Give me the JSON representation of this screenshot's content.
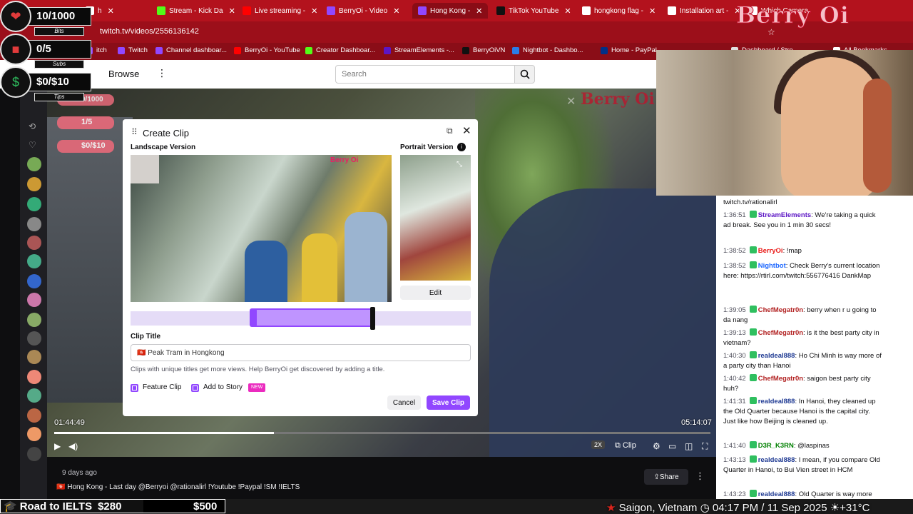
{
  "browser": {
    "tabs": [
      {
        "label": "h",
        "color": "#ffffff"
      },
      {
        "label": "Stream - Kick Da",
        "color": "#53fc18"
      },
      {
        "label": "Live streaming -",
        "color": "#ff0000"
      },
      {
        "label": "BerryOi - Video",
        "color": "#9147ff"
      },
      {
        "label": "Hong Kong -",
        "color": "#9147ff"
      },
      {
        "label": "TikTok YouTube",
        "color": "#111111"
      },
      {
        "label": "hongkong flag -",
        "color": "#ffffff"
      },
      {
        "label": "Installation art -",
        "color": "#ffffff"
      },
      {
        "label": "Which Camera",
        "color": "#ffffff"
      }
    ],
    "url": "twitch.tv/videos/2556136142",
    "bookmarks": [
      "itch",
      "Twitch",
      "Channel dashboar...",
      "BerryOi - YouTube",
      "Creator Dashboar...",
      "StreamElements -...",
      "BerryOiVN",
      "Nightbot - Dashbo...",
      "Home - PayPal",
      "Dashboard / Stre...",
      "All Bookmarks"
    ]
  },
  "twitch": {
    "browse": "Browse",
    "search_placeholder": "Search"
  },
  "overlay": {
    "bits": {
      "value": "10/1000",
      "label": "Bits"
    },
    "subs": {
      "value": "0/5",
      "label": "Subs"
    },
    "tips": {
      "value": "$0/$10",
      "label": "Tips"
    },
    "video_bits": "0/1000",
    "video_subs": "1/5",
    "video_tips": "$0/$10",
    "logo": "Berry Oi",
    "video_logo": "Berry Oi"
  },
  "player": {
    "time_current": "01:44:49",
    "time_total": "05:14:07",
    "progress": 0.335,
    "speed": "2X",
    "clip_label": "Clip"
  },
  "modal": {
    "title": "Create Clip",
    "landscape_label": "Landscape Version",
    "portrait_label": "Portrait Version",
    "edit": "Edit",
    "clip_title_label": "Clip Title",
    "clip_title_value": "Peak Tram in Hongkong",
    "hint": "Clips with unique titles get more views. Help BerryOi get discovered by adding a title.",
    "feature_clip": "Feature Clip",
    "add_to_story": "Add to Story",
    "new_badge": "NEW",
    "cancel": "Cancel",
    "save": "Save Clip",
    "thumb_text": "Berry Oi"
  },
  "video_info": {
    "ago": "9 days ago",
    "description": "Hong Kong - Last day @Berryoi @rationalirl !Youtube !Paypal !SM !IELTS",
    "share": "Share"
  },
  "chat": [
    {
      "ts": "",
      "user": "",
      "user_color": "#0e0e10",
      "text": "twitch.tv/rationalirl"
    },
    {
      "ts": "1:36:51",
      "user": "StreamElements",
      "user_color": "#5c16c5",
      "text": ": We're taking a quick ad break. See you in 1 min 30 secs!"
    },
    {
      "ts": "1:38:52",
      "user": "BerryOi",
      "user_color": "#e91916",
      "text": ": !map"
    },
    {
      "ts": "1:38:52",
      "user": "Nightbot",
      "user_color": "#1f69ff",
      "text": ": Check Berry's current location here: https://rtirl.com/twitch:556776416 DankMap"
    },
    {
      "ts": "1:39:05",
      "user": "ChefMegatr0n",
      "user_color": "#b22222",
      "text": ": berry when r u going to da nang"
    },
    {
      "ts": "1:39:13",
      "user": "ChefMegatr0n",
      "user_color": "#b22222",
      "text": ": is it the best party city in vietnam?"
    },
    {
      "ts": "1:40:30",
      "user": "realdeal888",
      "user_color": "#1f3a93",
      "text": ": Ho Chi Minh is way more of a party city than Hanoi"
    },
    {
      "ts": "1:40:42",
      "user": "ChefMegatr0n",
      "user_color": "#b22222",
      "text": ": saigon best party city huh?"
    },
    {
      "ts": "1:41:31",
      "user": "realdeal888",
      "user_color": "#1f3a93",
      "text": ": In Hanoi, they cleaned up the Old Quarter because Hanoi is the capital city. Just like how Beijing is cleaned up."
    },
    {
      "ts": "1:41:40",
      "user": "D3R_K3RN",
      "user_color": "#008000",
      "text": ": @laspinas"
    },
    {
      "ts": "1:43:13",
      "user": "realdeal888",
      "user_color": "#1f3a93",
      "text": ": I mean, if you compare Old Quarter in Hanoi, to Bui Vien street in HCM"
    },
    {
      "ts": "1:43:23",
      "user": "realdeal888",
      "user_color": "#1f3a93",
      "text": ": Old Quarter is way more trashy/wild than Bui Vien"
    }
  ],
  "bottom": {
    "goal_label": "Road to IELTS",
    "goal_current": "$280",
    "goal_target": "$500",
    "location": "Saigon, Vietnam",
    "time": "04:17 PM / 11 Sep 2025",
    "temp": "+31°C"
  },
  "colors": {
    "accent": "#9147ff",
    "browser_red": "#b3121d"
  }
}
